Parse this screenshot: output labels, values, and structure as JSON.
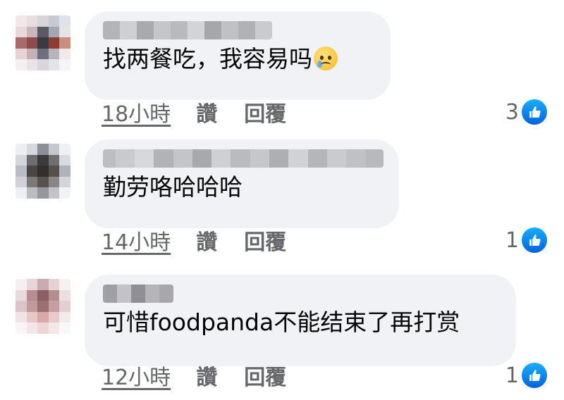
{
  "comments": [
    {
      "text": "找两餐吃，我容易吗",
      "has_emoji": true,
      "time": "18小時",
      "like_label": "讚",
      "reply_label": "回覆",
      "reaction_count": "3"
    },
    {
      "text": "勤劳咯哈哈哈",
      "has_emoji": false,
      "time": "14小時",
      "like_label": "讚",
      "reply_label": "回覆",
      "reaction_count": "1"
    },
    {
      "text": "可惜foodpanda不能结束了再打赏",
      "has_emoji": false,
      "time": "12小時",
      "like_label": "讚",
      "reply_label": "回覆",
      "reaction_count": "1"
    }
  ],
  "emoji_name": "crying-face-icon",
  "reaction_icon": "thumbs-up-icon",
  "colors": {
    "bubble": "#f0f2f5",
    "meta_text": "#65676b",
    "like_blue": "#1877f2"
  }
}
